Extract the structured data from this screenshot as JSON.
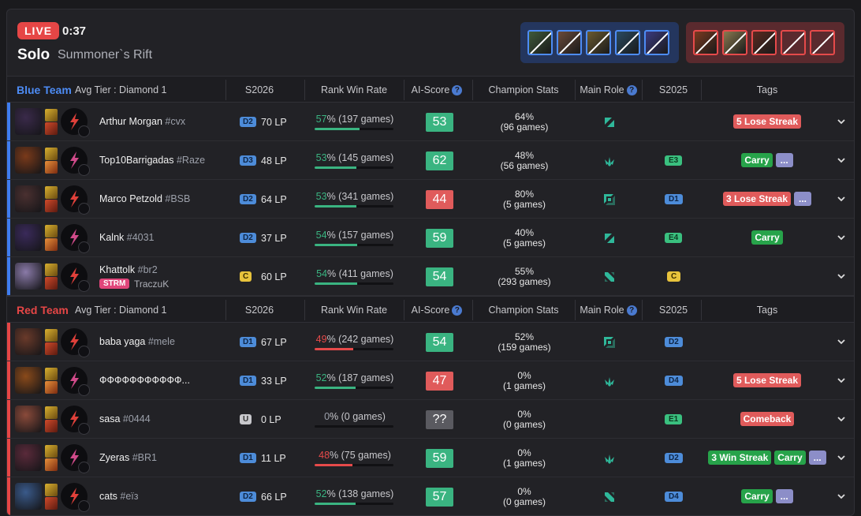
{
  "header": {
    "live_label": "LIVE",
    "timer": "0:37",
    "queue": "Solo",
    "map": "Summoner`s Rift"
  },
  "bans": {
    "blue": [
      "#3f5a3a",
      "#6a4a3a",
      "#6a5a30",
      "#2a4a60",
      "#3a3a80"
    ],
    "red": [
      "#7a3a20",
      "#8a7a50",
      "#5a2a20",
      "empty",
      "empty"
    ]
  },
  "columns": {
    "season": "S2026",
    "win_rate": "Rank Win Rate",
    "ai_score": "AI-Score",
    "champ_stats": "Champion Stats",
    "main_role": "Main Role",
    "prev_season": "S2025",
    "tags": "Tags"
  },
  "teams": [
    {
      "name": "Blue Team",
      "avg_tier": "Avg Tier : Diamond 1",
      "color": "#4d8cf5",
      "side": "blue",
      "players": [
        {
          "name": "Arthur Morgan",
          "tag": "#cvx",
          "champ_color": "#3a2a4a",
          "tier": "D2",
          "tier_type": "d",
          "lp": "70 LP",
          "wr": "57",
          "wr_text": "% (197 games)",
          "wr_class": "g",
          "score": "53",
          "score_class": "g",
          "cs_pct": "64%",
          "cs_games": "(96 games)",
          "role": "jungle",
          "prev": "",
          "prev_type": "",
          "tags": [
            {
              "t": "5 Lose Streak",
              "c": "red"
            }
          ]
        },
        {
          "name": "Top10Barrigadas",
          "tag": "#Raze",
          "champ_color": "#7a3a1a",
          "tier": "D3",
          "tier_type": "d",
          "lp": "48 LP",
          "wr": "53",
          "wr_text": "% (145 games)",
          "wr_class": "g",
          "score": "62",
          "score_class": "g",
          "cs_pct": "48%",
          "cs_games": "(56 games)",
          "role": "support",
          "prev": "E3",
          "prev_type": "e",
          "tags": [
            {
              "t": "Carry",
              "c": "green"
            },
            {
              "t": "...",
              "c": "more"
            }
          ]
        },
        {
          "name": "Marco Petzold",
          "tag": "#BSB",
          "champ_color": "#4a3030",
          "tier": "D2",
          "tier_type": "d",
          "lp": "64 LP",
          "wr": "53",
          "wr_text": "% (341 games)",
          "wr_class": "g",
          "score": "44",
          "score_class": "r",
          "cs_pct": "80%",
          "cs_games": "(5 games)",
          "role": "top",
          "prev": "D1",
          "prev_type": "d",
          "tags": [
            {
              "t": "3 Lose Streak",
              "c": "red"
            },
            {
              "t": "...",
              "c": "more"
            }
          ]
        },
        {
          "name": "Kalnk",
          "tag": "#4031",
          "champ_color": "#3a2a5a",
          "tier": "D2",
          "tier_type": "d",
          "lp": "37 LP",
          "wr": "54",
          "wr_text": "% (157 games)",
          "wr_class": "g",
          "score": "59",
          "score_class": "g",
          "cs_pct": "40%",
          "cs_games": "(5 games)",
          "role": "jungle",
          "prev": "E4",
          "prev_type": "e",
          "tags": [
            {
              "t": "Carry",
              "c": "green"
            }
          ]
        },
        {
          "name": "Khattolk",
          "tag": "#br2",
          "streamer": "STRM",
          "alias": "TraczuK",
          "champ_color": "#8a7aa8",
          "tier": "C",
          "tier_type": "c",
          "lp": "60 LP",
          "wr": "54",
          "wr_text": "% (411 games)",
          "wr_class": "g",
          "score": "54",
          "score_class": "g",
          "cs_pct": "55%",
          "cs_games": "(293 games)",
          "role": "mid",
          "prev": "C",
          "prev_type": "c",
          "tags": []
        }
      ]
    },
    {
      "name": "Red Team",
      "avg_tier": "Avg Tier : Diamond 1",
      "color": "#e64646",
      "side": "red",
      "players": [
        {
          "name": "baba yaga",
          "tag": "#mele",
          "champ_color": "#6a3a2a",
          "tier": "D1",
          "tier_type": "d",
          "lp": "67 LP",
          "wr": "49",
          "wr_text": "% (242 games)",
          "wr_class": "r",
          "score": "54",
          "score_class": "g",
          "cs_pct": "52%",
          "cs_games": "(159 games)",
          "role": "top",
          "prev": "D2",
          "prev_type": "d",
          "tags": []
        },
        {
          "name": "ФФФФФФФФФФФ...",
          "tag": "",
          "champ_color": "#8a4a1a",
          "tier": "D1",
          "tier_type": "d",
          "lp": "33 LP",
          "wr": "52",
          "wr_text": "% (187 games)",
          "wr_class": "g",
          "score": "47",
          "score_class": "r",
          "cs_pct": "0%",
          "cs_games": "(1 games)",
          "role": "support",
          "prev": "D4",
          "prev_type": "d",
          "tags": [
            {
              "t": "5 Lose Streak",
              "c": "red"
            }
          ]
        },
        {
          "name": "sasa",
          "tag": "#0444",
          "champ_color": "#8a4a3a",
          "tier": "U",
          "tier_type": "u",
          "lp": "0 LP",
          "wr": "0",
          "wr_text": "% (0 games)",
          "wr_class": "z",
          "score": "??",
          "score_class": "z",
          "cs_pct": "0%",
          "cs_games": "(0 games)",
          "role": "",
          "prev": "E1",
          "prev_type": "e",
          "tags": [
            {
              "t": "Comeback",
              "c": "red"
            }
          ]
        },
        {
          "name": "Zyeras",
          "tag": "#BR1",
          "champ_color": "#5a2a3a",
          "tier": "D1",
          "tier_type": "d",
          "lp": "11 LP",
          "wr": "48",
          "wr_text": "% (75 games)",
          "wr_class": "r",
          "score": "59",
          "score_class": "g",
          "cs_pct": "0%",
          "cs_games": "(1 games)",
          "role": "support",
          "prev": "D2",
          "prev_type": "d",
          "tags": [
            {
              "t": "3 Win Streak",
              "c": "green"
            },
            {
              "t": "Carry",
              "c": "green"
            },
            {
              "t": "...",
              "c": "more"
            }
          ]
        },
        {
          "name": "cats",
          "tag": "#eïз",
          "champ_color": "#3a5a8a",
          "tier": "D2",
          "tier_type": "d",
          "lp": "66 LP",
          "wr": "52",
          "wr_text": "% (138 games)",
          "wr_class": "g",
          "score": "57",
          "score_class": "g",
          "cs_pct": "0%",
          "cs_games": "(0 games)",
          "role": "mid",
          "prev": "D4",
          "prev_type": "d",
          "tags": [
            {
              "t": "Carry",
              "c": "green"
            },
            {
              "t": "...",
              "c": "more"
            }
          ]
        }
      ]
    }
  ]
}
